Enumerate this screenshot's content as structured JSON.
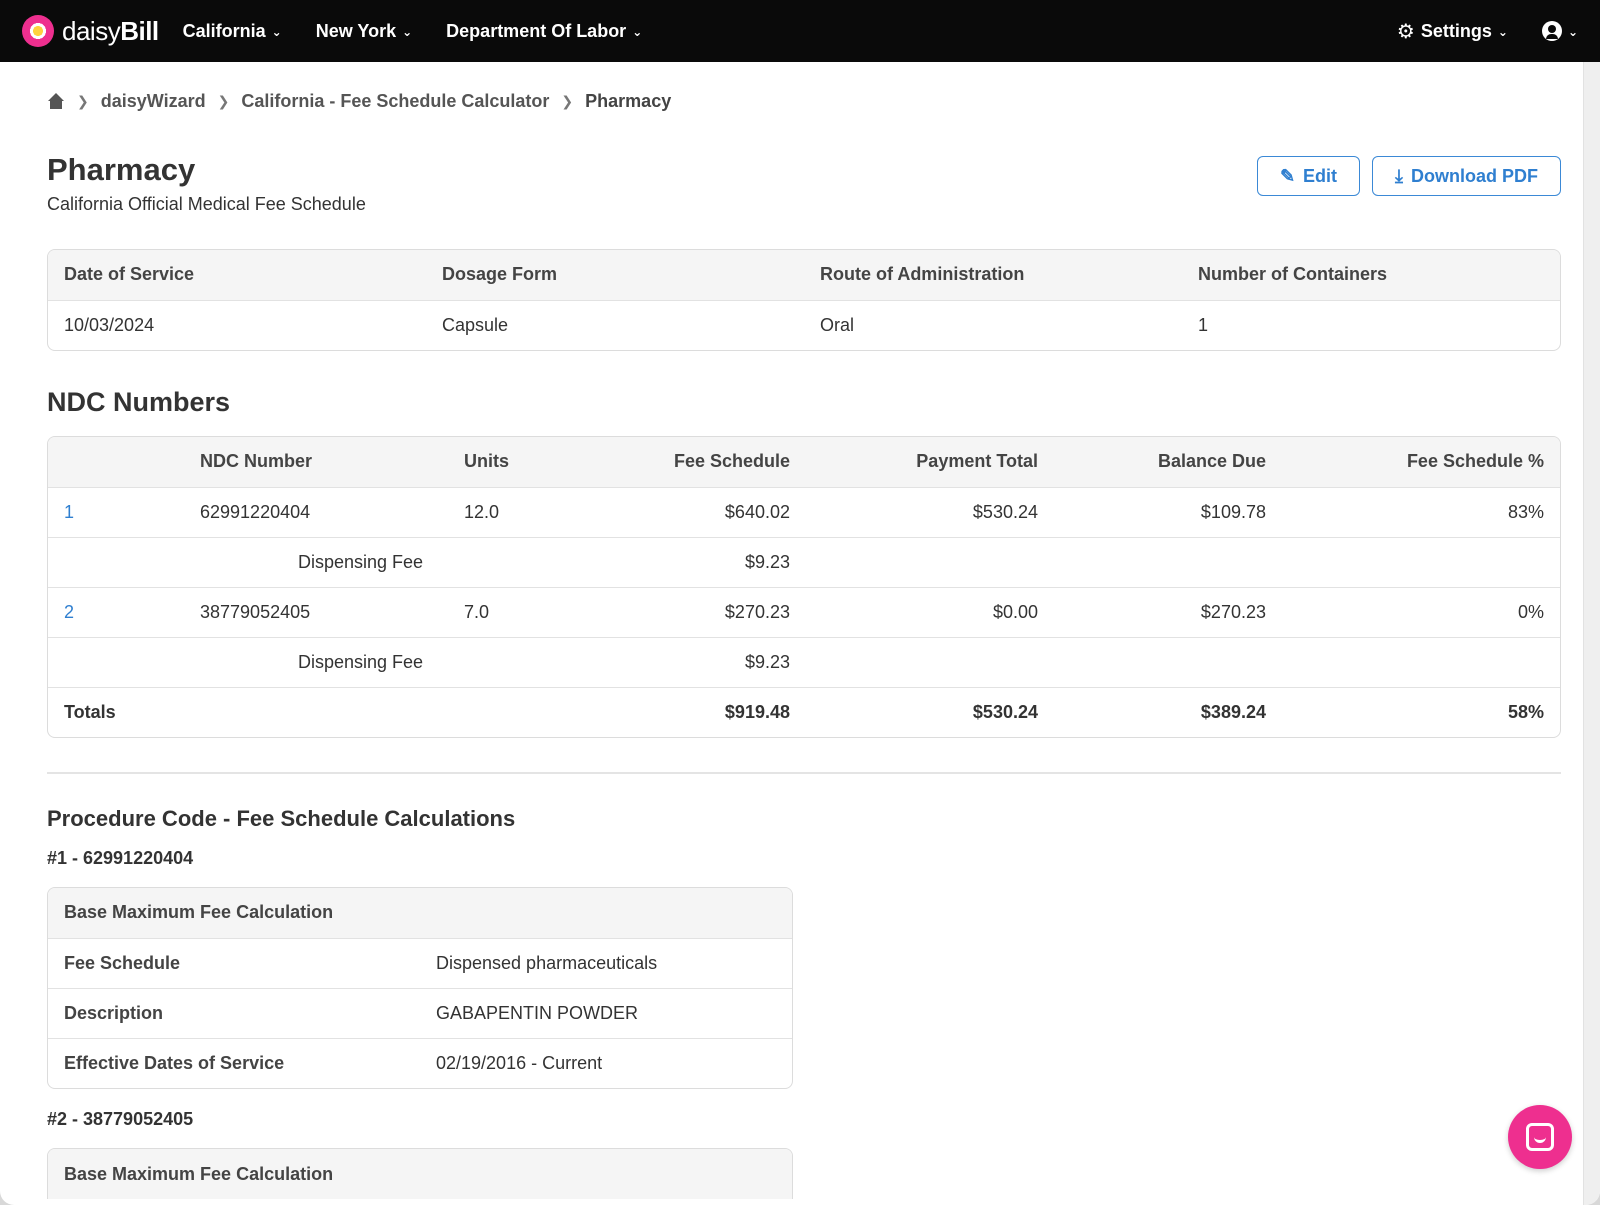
{
  "nav": {
    "logo_light": "daisy",
    "logo_bold": "Bill",
    "items": [
      "California",
      "New York",
      "Department Of Labor"
    ],
    "settings_label": "Settings"
  },
  "breadcrumb": {
    "items": [
      "daisyWizard",
      "California - Fee Schedule Calculator",
      "Pharmacy"
    ]
  },
  "header": {
    "title": "Pharmacy",
    "subtitle": "California Official Medical Fee Schedule",
    "edit_label": "Edit",
    "download_label": "Download PDF"
  },
  "service": {
    "columns": [
      "Date of Service",
      "Dosage Form",
      "Route of Administration",
      "Number of Containers"
    ],
    "values": [
      "10/03/2024",
      "Capsule",
      "Oral",
      "1"
    ]
  },
  "ndc": {
    "title": "NDC Numbers",
    "columns": [
      "NDC Number",
      "Units",
      "Fee Schedule",
      "Payment Total",
      "Balance Due",
      "Fee Schedule %"
    ],
    "rows": [
      {
        "index": "1",
        "ndc": "62991220404",
        "units": "12.0",
        "fee": "$640.02",
        "payment": "$530.24",
        "balance": "$109.78",
        "pct": "83%"
      },
      {
        "dispensing_label": "Dispensing Fee",
        "dispensing_fee": "$9.23"
      },
      {
        "index": "2",
        "ndc": "38779052405",
        "units": "7.0",
        "fee": "$270.23",
        "payment": "$0.00",
        "balance": "$270.23",
        "pct": "0%"
      },
      {
        "dispensing_label": "Dispensing Fee",
        "dispensing_fee": "$9.23"
      }
    ],
    "totals": {
      "label": "Totals",
      "fee": "$919.48",
      "payment": "$530.24",
      "balance": "$389.24",
      "pct": "58%"
    }
  },
  "procedure": {
    "title": "Procedure Code - Fee Schedule Calculations",
    "items": [
      {
        "title": "#1 - 62991220404",
        "table_header": "Base Maximum Fee Calculation",
        "rows": [
          {
            "label": "Fee Schedule",
            "value": "Dispensed pharmaceuticals"
          },
          {
            "label": "Description",
            "value": "GABAPENTIN POWDER"
          },
          {
            "label": "Effective Dates of Service",
            "value": "02/19/2016 - Current"
          }
        ]
      },
      {
        "title": "#2 - 38779052405",
        "table_header": "Base Maximum Fee Calculation"
      }
    ]
  }
}
